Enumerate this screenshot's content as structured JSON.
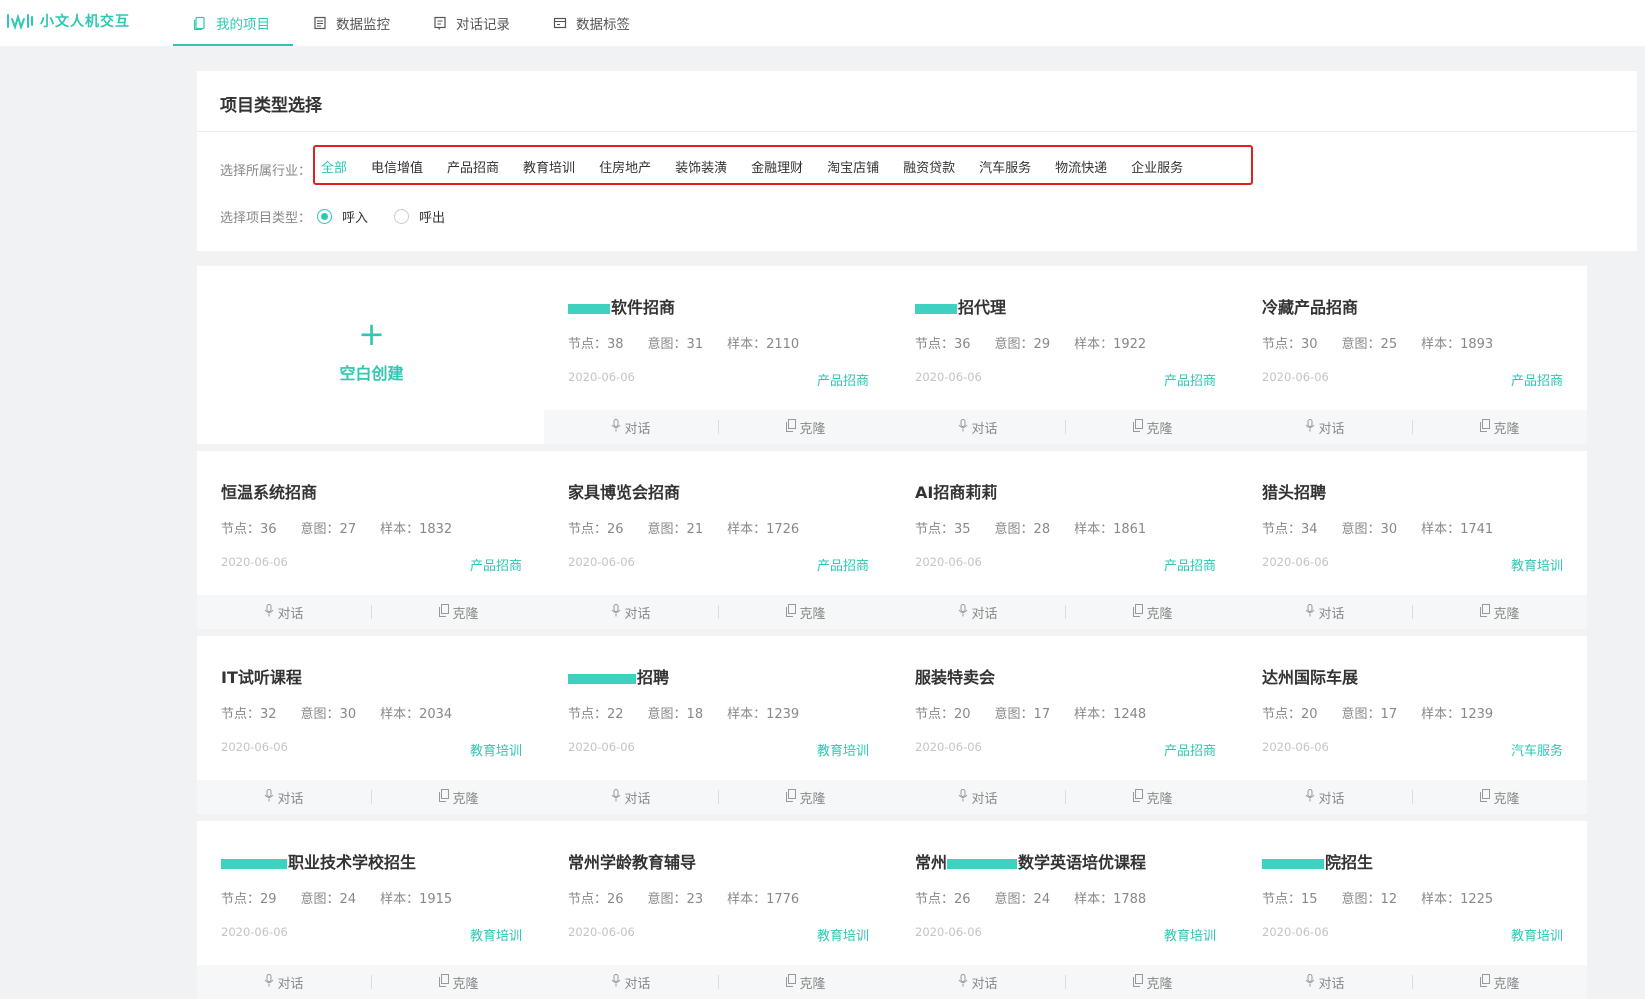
{
  "app": {
    "logo_text": "小文人机交互"
  },
  "nav": [
    {
      "label": "我的项目",
      "icon": "document-icon",
      "active": true
    },
    {
      "label": "数据监控",
      "icon": "monitor-icon",
      "active": false
    },
    {
      "label": "对话记录",
      "icon": "chat-record-icon",
      "active": false
    },
    {
      "label": "数据标签",
      "icon": "tag-icon",
      "active": false
    }
  ],
  "panel": {
    "title": "项目类型选择",
    "industry_label": "选择所属行业：",
    "industries": [
      "全部",
      "电信增值",
      "产品招商",
      "教育培训",
      "住房地产",
      "装饰装潢",
      "金融理财",
      "淘宝店铺",
      "融资贷款",
      "汽车服务",
      "物流快递",
      "企业服务"
    ],
    "active_industry": "全部",
    "type_label": "选择项目类型：",
    "type_options": [
      "呼入",
      "呼出"
    ],
    "type_selected": "呼入"
  },
  "create": {
    "plus": "+",
    "label": "空白创建"
  },
  "card_labels": {
    "nodes": "节点：",
    "intents": "意图：",
    "samples": "样本：",
    "chat": "对话",
    "clone": "克隆"
  },
  "cards": [
    {
      "title": "软件招商",
      "redact_width": 42,
      "nodes": "38",
      "intents": "31",
      "samples": "2110",
      "date": "2020-06-06",
      "tag": "产品招商"
    },
    {
      "title": "招代理",
      "redact_width": 42,
      "nodes": "36",
      "intents": "29",
      "samples": "1922",
      "date": "2020-06-06",
      "tag": "产品招商"
    },
    {
      "title": "冷藏产品招商",
      "redact_width": 0,
      "nodes": "30",
      "intents": "25",
      "samples": "1893",
      "date": "2020-06-06",
      "tag": "产品招商"
    },
    {
      "title": "恒温系统招商",
      "redact_width": 0,
      "nodes": "36",
      "intents": "27",
      "samples": "1832",
      "date": "2020-06-06",
      "tag": "产品招商"
    },
    {
      "title": "家具博览会招商",
      "redact_width": 0,
      "nodes": "26",
      "intents": "21",
      "samples": "1726",
      "date": "2020-06-06",
      "tag": "产品招商"
    },
    {
      "title": "AI招商莉莉",
      "redact_width": 0,
      "nodes": "35",
      "intents": "28",
      "samples": "1861",
      "date": "2020-06-06",
      "tag": "产品招商"
    },
    {
      "title": "猎头招聘",
      "redact_width": 0,
      "nodes": "34",
      "intents": "30",
      "samples": "1741",
      "date": "2020-06-06",
      "tag": "教育培训"
    },
    {
      "title": "IT试听课程",
      "redact_width": 0,
      "nodes": "32",
      "intents": "30",
      "samples": "2034",
      "date": "2020-06-06",
      "tag": "教育培训"
    },
    {
      "title": "招聘",
      "redact_width": 68,
      "nodes": "22",
      "intents": "18",
      "samples": "1239",
      "date": "2020-06-06",
      "tag": "教育培训"
    },
    {
      "title": "服装特卖会",
      "redact_width": 0,
      "nodes": "20",
      "intents": "17",
      "samples": "1248",
      "date": "2020-06-06",
      "tag": "产品招商"
    },
    {
      "title": "达州国际车展",
      "redact_width": 0,
      "nodes": "20",
      "intents": "17",
      "samples": "1239",
      "date": "2020-06-06",
      "tag": "汽车服务"
    },
    {
      "title": "职业技术学校招生",
      "redact_width": 66,
      "nodes": "29",
      "intents": "24",
      "samples": "1915",
      "date": "2020-06-06",
      "tag": "教育培训"
    },
    {
      "title": "常州学龄教育辅导",
      "redact_width": 0,
      "nodes": "26",
      "intents": "23",
      "samples": "1776",
      "date": "2020-06-06",
      "tag": "教育培训"
    },
    {
      "title": "常州",
      "title_suffix": "数学英语培优课程",
      "redact_width": 70,
      "redact_mid": true,
      "nodes": "26",
      "intents": "24",
      "samples": "1788",
      "date": "2020-06-06",
      "tag": "教育培训"
    },
    {
      "title": "院招生",
      "redact_width": 62,
      "nodes": "15",
      "intents": "12",
      "samples": "1225",
      "date": "2020-06-06",
      "tag": "教育培训"
    }
  ]
}
